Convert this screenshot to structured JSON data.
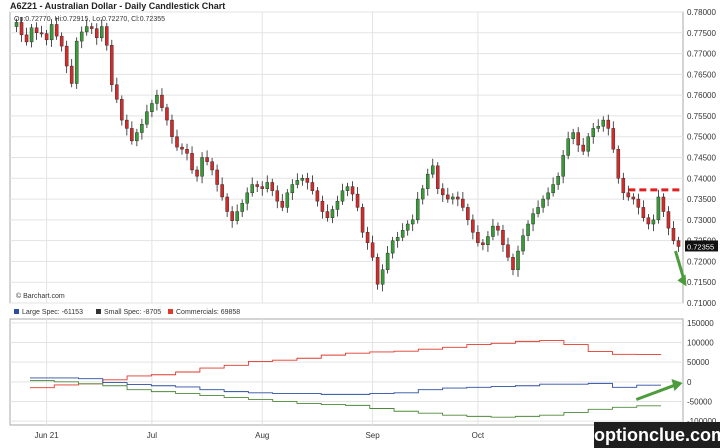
{
  "header": {
    "title": "A6Z21 - Australian Dollar - Daily Candlestick Chart"
  },
  "price_panel": {
    "ohlc_text": "Op:0.72770, Hi:0.72915, Lo:0.72270, Cl:0.72355",
    "last_price_label": "0.72355",
    "copyright": "© Barchart.com"
  },
  "cot_panel": {
    "legend": [
      {
        "label": "Large Spec: -61153",
        "color": "#2d4fa1"
      },
      {
        "label": "Small Spec: -8705",
        "color": "#333333"
      },
      {
        "label": "Commercials: 69858",
        "color": "#e0392b"
      }
    ]
  },
  "watermark": "optionclue.com",
  "colors": {
    "bull": "#3a9a3a",
    "bear": "#d22b2b",
    "grid": "#e3e3e3",
    "arrow": "#4c9b3c",
    "resistance": "#e02020",
    "large_spec": "#2d4fa1",
    "small_spec": "#4f8a3a",
    "commercials": "#e0392b"
  },
  "chart_data": [
    {
      "type": "candlestick",
      "title": "A6Z21 - Australian Dollar - Daily Candlestick Chart",
      "x_labels": [
        {
          "label": "Jun 21",
          "index": 6
        },
        {
          "label": "Jul",
          "index": 27
        },
        {
          "label": "Aug",
          "index": 49
        },
        {
          "label": "Sep",
          "index": 71
        },
        {
          "label": "Oct",
          "index": 92
        }
      ],
      "y_ticks": [
        "0.71000",
        "0.71500",
        "0.72000",
        "0.72500",
        "0.73000",
        "0.73500",
        "0.74000",
        "0.74500",
        "0.75000",
        "0.75500",
        "0.76000",
        "0.76500",
        "0.77000",
        "0.77500",
        "0.78000"
      ],
      "ylim": [
        0.71,
        0.78
      ],
      "grid": true,
      "closes": [
        0.7775,
        0.7745,
        0.7728,
        0.7762,
        0.775,
        0.7748,
        0.7733,
        0.777,
        0.7742,
        0.7718,
        0.767,
        0.7628,
        0.773,
        0.7752,
        0.7765,
        0.776,
        0.7738,
        0.7765,
        0.772,
        0.7625,
        0.759,
        0.754,
        0.752,
        0.749,
        0.751,
        0.753,
        0.756,
        0.758,
        0.76,
        0.757,
        0.754,
        0.75,
        0.7475,
        0.747,
        0.746,
        0.742,
        0.7405,
        0.745,
        0.744,
        0.742,
        0.7385,
        0.7355,
        0.732,
        0.7298,
        0.732,
        0.734,
        0.7365,
        0.7385,
        0.738,
        0.7375,
        0.739,
        0.737,
        0.7345,
        0.733,
        0.7365,
        0.7385,
        0.7395,
        0.74,
        0.739,
        0.737,
        0.7345,
        0.732,
        0.7305,
        0.7325,
        0.7345,
        0.737,
        0.738,
        0.7362,
        0.733,
        0.727,
        0.7245,
        0.721,
        0.7145,
        0.718,
        0.722,
        0.725,
        0.7258,
        0.7275,
        0.729,
        0.73,
        0.735,
        0.7375,
        0.741,
        0.743,
        0.7375,
        0.736,
        0.735,
        0.7355,
        0.735,
        0.733,
        0.73,
        0.727,
        0.7245,
        0.724,
        0.726,
        0.7285,
        0.7275,
        0.724,
        0.721,
        0.718,
        0.7225,
        0.7262,
        0.729,
        0.7315,
        0.733,
        0.735,
        0.7365,
        0.7385,
        0.7405,
        0.7455,
        0.7495,
        0.751,
        0.748,
        0.7465,
        0.75,
        0.752,
        0.7525,
        0.754,
        0.752,
        0.747,
        0.74,
        0.7365,
        0.7355,
        0.735,
        0.733,
        0.7305,
        0.729,
        0.73,
        0.7355,
        0.732,
        0.728,
        0.725,
        0.7236
      ]
    },
    {
      "type": "line",
      "title": "",
      "y_ticks": [
        {
          "label": "150000",
          "value": 150000
        },
        {
          "label": "100000",
          "value": 100000
        },
        {
          "label": "50000",
          "value": 50000
        },
        {
          "label": "0",
          "value": 0
        },
        {
          "label": "-50000",
          "value": -50000
        },
        {
          "label": "-100000",
          "value": -100000
        }
      ],
      "ylim": [
        -110000,
        160000
      ],
      "series": [
        {
          "name": "Commercials: 69858",
          "color": "#e0392b",
          "weeks": [
            -15000,
            -8000,
            -5000,
            5000,
            15000,
            18000,
            25000,
            35000,
            42000,
            52000,
            55000,
            60000,
            68000,
            73000,
            76000,
            78000,
            83000,
            88000,
            95000,
            98000,
            103000,
            105000,
            95000,
            77000,
            70000,
            69858
          ]
        },
        {
          "name": "Large Spec: -61153",
          "color": "#2d4fa1",
          "weeks": [
            10000,
            10000,
            8000,
            -2000,
            -7000,
            -10000,
            -13000,
            -20000,
            -25000,
            -28000,
            -30000,
            -30000,
            -32000,
            -32000,
            -30000,
            -28000,
            -20000,
            -16000,
            -14000,
            -12000,
            -10000,
            -6000,
            -6000,
            -4000,
            -14000,
            -8705
          ]
        },
        {
          "name": "Small Spec: -8705",
          "color": "#4f8a3a",
          "weeks": [
            3000,
            0,
            -5000,
            -10000,
            -20000,
            -25000,
            -30000,
            -35000,
            -40000,
            -45000,
            -50000,
            -55000,
            -58000,
            -60000,
            -68000,
            -75000,
            -80000,
            -85000,
            -88000,
            -90000,
            -88000,
            -85000,
            -78000,
            -70000,
            -65000,
            -61153
          ]
        }
      ]
    }
  ]
}
